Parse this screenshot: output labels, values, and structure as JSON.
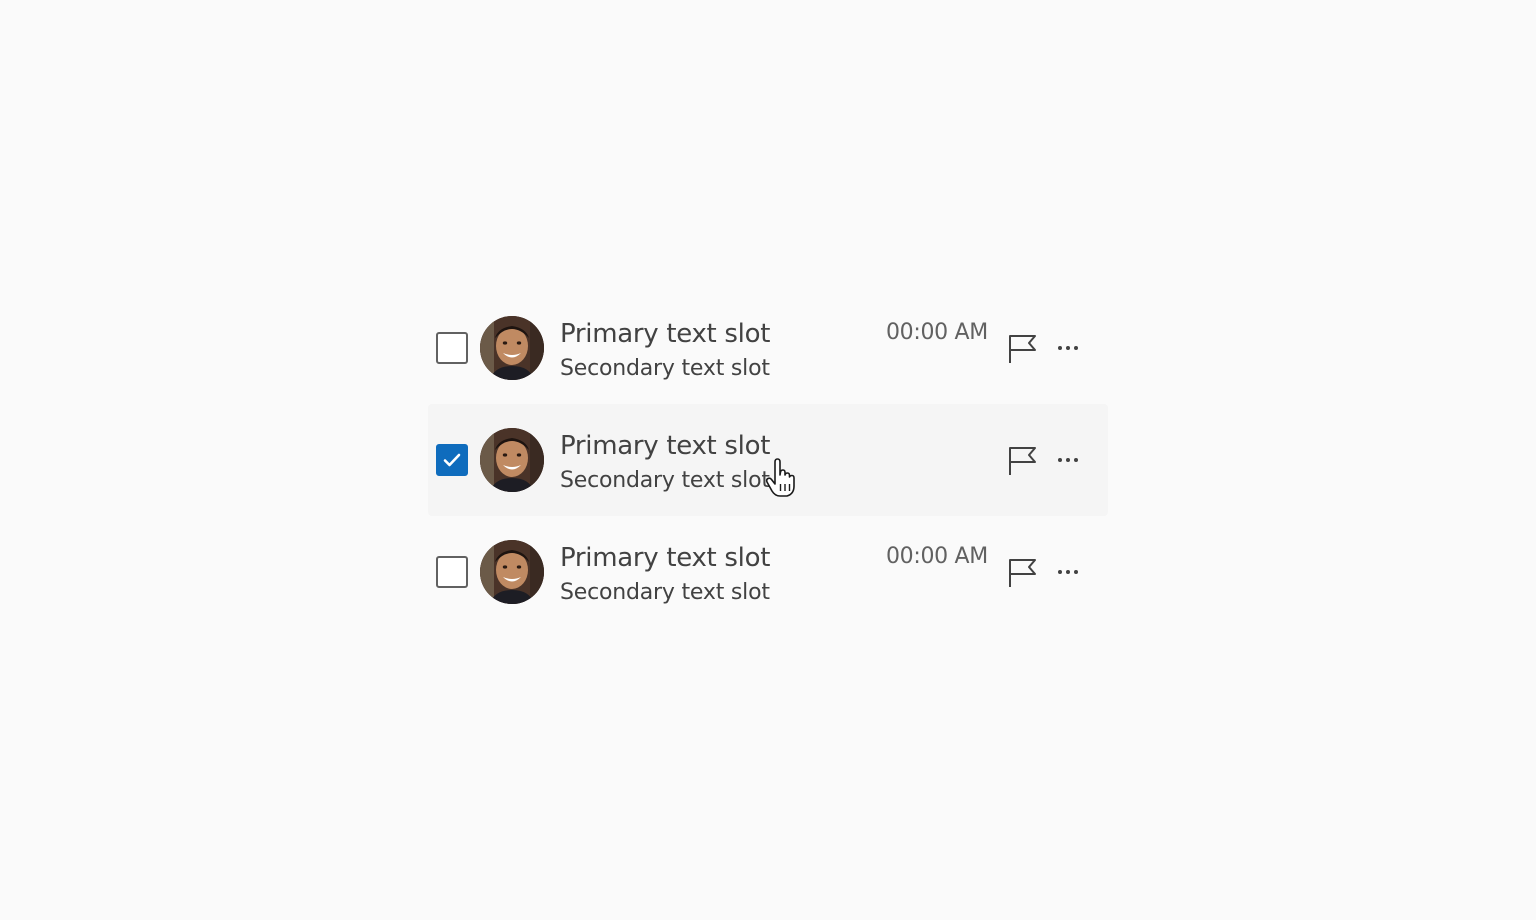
{
  "list": {
    "rows": [
      {
        "primary": "Primary text slot",
        "secondary": "Secondary text slot",
        "time": "00:00 AM",
        "checked": false
      },
      {
        "primary": "Primary text slot",
        "secondary": "Secondary text slot",
        "time": "",
        "checked": true
      },
      {
        "primary": "Primary text slot",
        "secondary": "Secondary text slot",
        "time": "00:00 AM",
        "checked": false
      }
    ]
  },
  "icons": {
    "flag": "flag-icon",
    "more": "more-horizontal-icon",
    "check": "checkmark-icon",
    "cursor": "hand-pointer-icon"
  },
  "colors": {
    "background": "#fafafa",
    "hover_row": "#f5f5f5",
    "checkbox_checked": "#0f6cbd",
    "text": "#424242",
    "time_text": "#616161"
  }
}
